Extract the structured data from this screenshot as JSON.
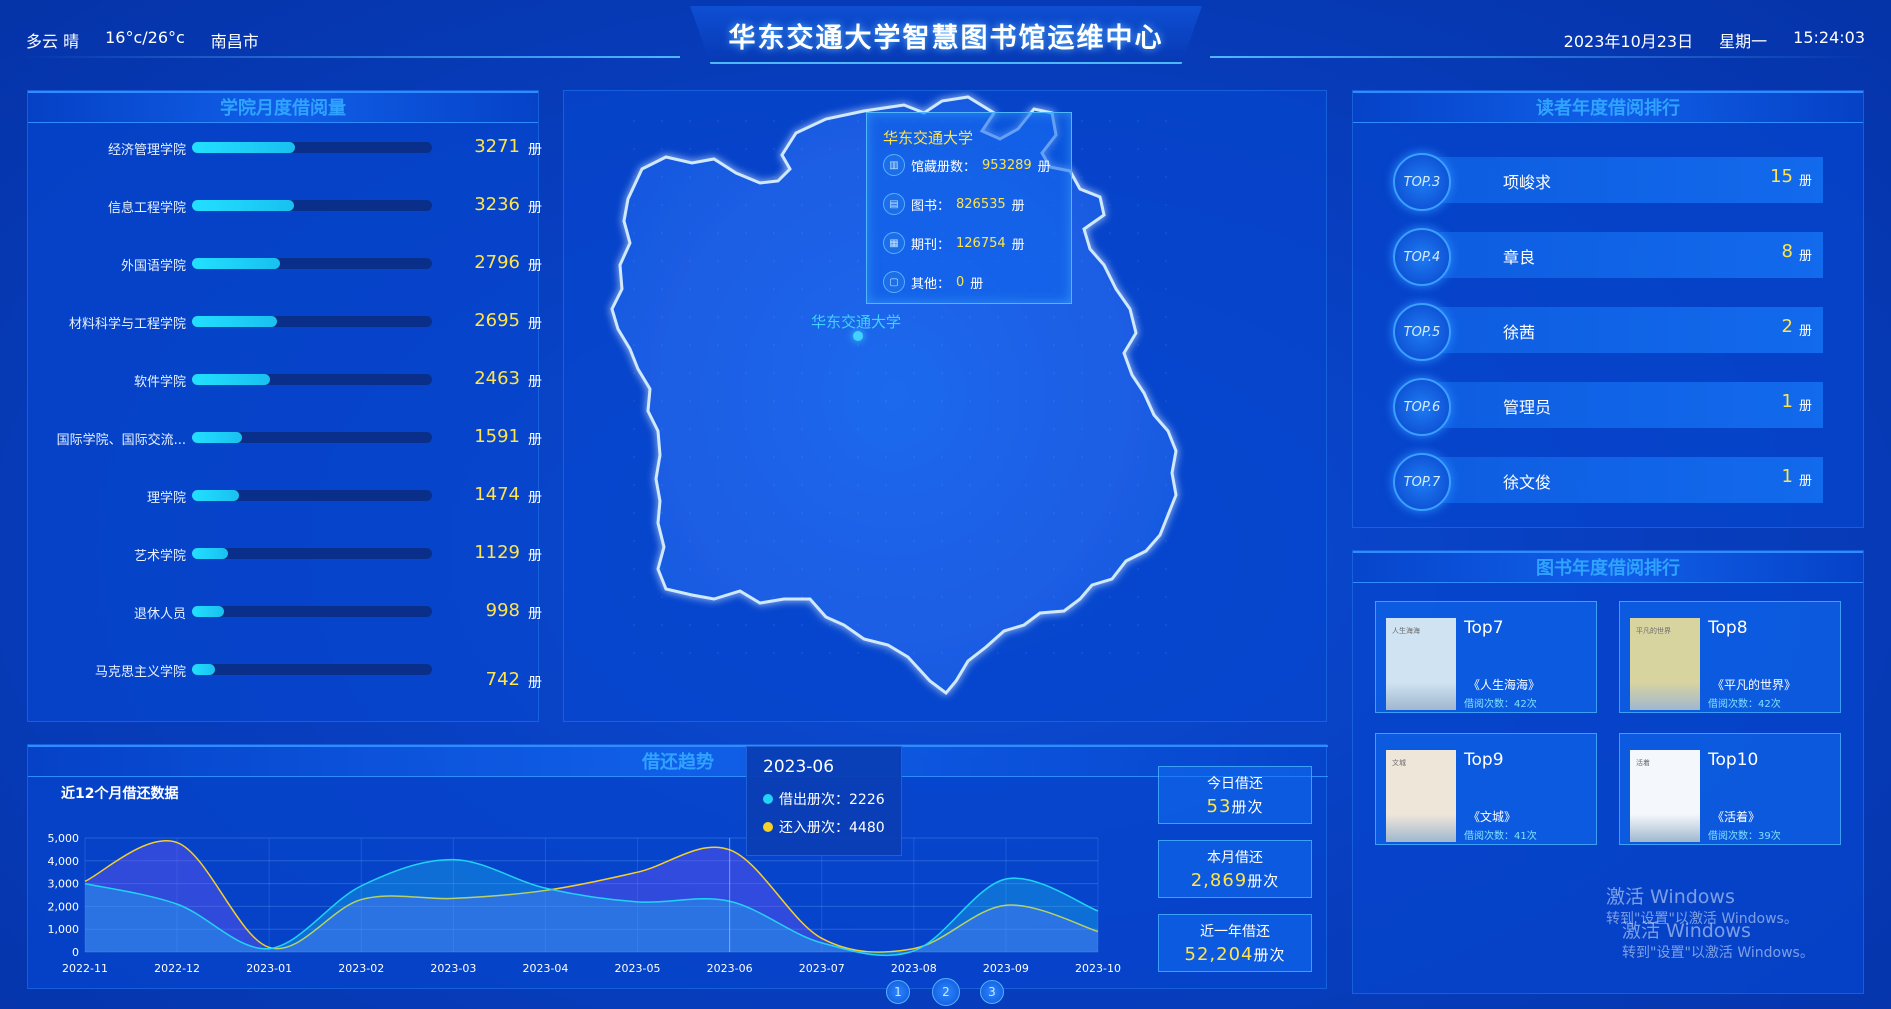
{
  "header": {
    "weather": "多云 晴",
    "temperature": "16°c/26°c",
    "city": "南昌市",
    "title": "华东交通大学智慧图书馆运维中心",
    "date": "2023年10月23日",
    "weekday": "星期一",
    "time": "15:24:03"
  },
  "colleges": {
    "title": "学院月度借阅量",
    "unit": "册",
    "max": 5000,
    "rows": [
      {
        "name": "经济管理学院",
        "value": 3271
      },
      {
        "name": "信息工程学院",
        "value": 3236
      },
      {
        "name": "外国语学院",
        "value": 2796
      },
      {
        "name": "材料科学与工程学院",
        "value": 2695
      },
      {
        "name": "软件学院",
        "value": 2463
      },
      {
        "name": "国际学院、国际交流...",
        "value": 1591
      },
      {
        "name": "理学院",
        "value": 1474
      },
      {
        "name": "艺术学院",
        "value": 1129
      },
      {
        "name": "退休人员",
        "value": 998
      },
      {
        "name": "马克思主义学院",
        "value": 742
      }
    ]
  },
  "map": {
    "card_title": "华东交通大学",
    "items": [
      {
        "icon": "building-icon",
        "label": "馆藏册数：",
        "value": "953289",
        "unit": "册"
      },
      {
        "icon": "book-icon",
        "label": "图书：",
        "value": "826535",
        "unit": "册"
      },
      {
        "icon": "journal-icon",
        "label": "期刊：",
        "value": "126754",
        "unit": "册"
      },
      {
        "icon": "file-icon",
        "label": "其他：",
        "value": "0",
        "unit": "册"
      }
    ],
    "marker_label": "华东交通大学"
  },
  "readers": {
    "title": "读者年度借阅排行",
    "unit": "册",
    "rows": [
      {
        "rank": "TOP.3",
        "name": "项峻求",
        "count": "15"
      },
      {
        "rank": "TOP.4",
        "name": "章良",
        "count": "8"
      },
      {
        "rank": "TOP.5",
        "name": "徐茜",
        "count": "2"
      },
      {
        "rank": "TOP.6",
        "name": "管理员",
        "count": "1"
      },
      {
        "rank": "TOP.7",
        "name": "徐文俊",
        "count": "1"
      }
    ]
  },
  "books": {
    "title": "图书年度借阅排行",
    "items": [
      {
        "rank": "Top7",
        "title": "《人生海海》",
        "count": "借阅次数：42次",
        "cover_color": "#cfe3f2",
        "cover_text": "人生海海"
      },
      {
        "rank": "Top8",
        "title": "《平凡的世界》",
        "count": "借阅次数：42次",
        "cover_color": "#d8d4a0",
        "cover_text": "平凡的世界"
      },
      {
        "rank": "Top9",
        "title": "《文城》",
        "count": "借阅次数：41次",
        "cover_color": "#efe6da",
        "cover_text": "文城"
      },
      {
        "rank": "Top10",
        "title": "《活着》",
        "count": "借阅次数：39次",
        "cover_color": "#f4f7fb",
        "cover_text": "活着"
      }
    ]
  },
  "trend": {
    "title": "借还趋势",
    "subtitle": "近12个月借还数据",
    "stats": [
      {
        "label": "今日借还",
        "value": "53",
        "unit": "册次"
      },
      {
        "label": "本月借还",
        "value": "2,869",
        "unit": "册次"
      },
      {
        "label": "近一年借还",
        "value": "52,204",
        "unit": "册次"
      }
    ],
    "tooltip": {
      "month": "2023-06",
      "borrow_label": "借出册次：2226",
      "return_label": "还入册次：4480"
    },
    "pages": [
      "1",
      "2",
      "3"
    ],
    "colors": {
      "borrow": "#22d3f5",
      "return": "#f5d02a"
    }
  },
  "chart_data": {
    "type": "area",
    "x": [
      "2022-11",
      "2022-12",
      "2023-01",
      "2023-02",
      "2023-03",
      "2023-04",
      "2023-05",
      "2023-06",
      "2023-07",
      "2023-08",
      "2023-09",
      "2023-10"
    ],
    "series": [
      {
        "name": "借出册次",
        "values": [
          3000,
          2100,
          150,
          2900,
          4050,
          2800,
          2200,
          2226,
          400,
          50,
          3200,
          1800
        ]
      },
      {
        "name": "还入册次",
        "values": [
          3100,
          4800,
          200,
          2300,
          2350,
          2700,
          3500,
          4480,
          600,
          150,
          2050,
          900
        ]
      }
    ],
    "ylim": [
      0,
      5000
    ],
    "yticks": [
      "0",
      "1,000",
      "2,000",
      "3,000",
      "4,000",
      "5,000"
    ],
    "grid": true
  },
  "watermark": {
    "line1": "激活 Windows",
    "line2": "转到\"设置\"以激活 Windows。"
  }
}
